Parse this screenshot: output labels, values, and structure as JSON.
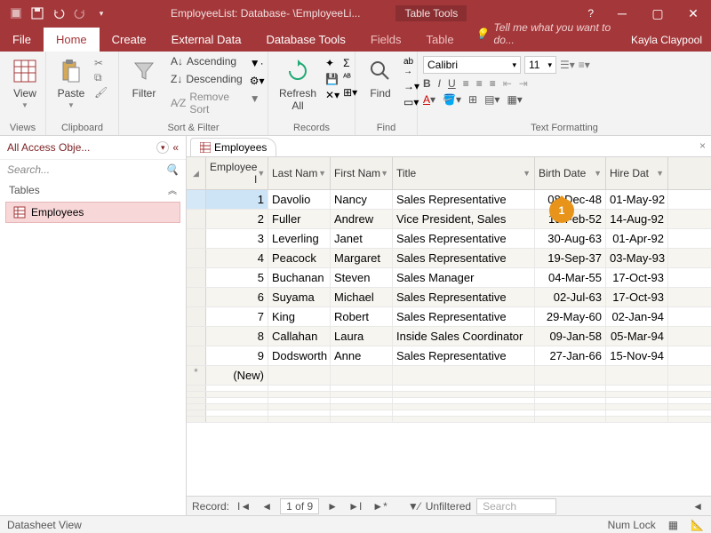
{
  "titlebar": {
    "app_title": "EmployeeList: Database- \\EmployeeLi...",
    "context_tab": "Table Tools",
    "help": "?"
  },
  "tabs": {
    "file": "File",
    "home": "Home",
    "create": "Create",
    "external": "External Data",
    "dbtools": "Database Tools",
    "fields": "Fields",
    "table": "Table",
    "tellme": "Tell me what you want to do...",
    "user": "Kayla Claypool"
  },
  "ribbon": {
    "views": {
      "view": "View",
      "label": "Views"
    },
    "clipboard": {
      "paste": "Paste",
      "label": "Clipboard"
    },
    "sort": {
      "filter": "Filter",
      "asc": "Ascending",
      "desc": "Descending",
      "remove": "Remove Sort",
      "label": "Sort & Filter"
    },
    "records": {
      "refresh": "Refresh\nAll",
      "label": "Records"
    },
    "find": {
      "find": "Find",
      "label": "Find"
    },
    "text": {
      "font": "Calibri",
      "size": "11",
      "label": "Text Formatting"
    }
  },
  "nav": {
    "header": "All Access Obje...",
    "search": "Search...",
    "group": "Tables",
    "item": "Employees"
  },
  "doc": {
    "tab": "Employees"
  },
  "columns": [
    "Employee I",
    "Last Nam",
    "First Nam",
    "Title",
    "Birth Date",
    "Hire Dat"
  ],
  "rows": [
    {
      "id": "1",
      "ln": "Davolio",
      "fn": "Nancy",
      "ti": "Sales Representative",
      "bd": "08-Dec-48",
      "hd": "01-May-92"
    },
    {
      "id": "2",
      "ln": "Fuller",
      "fn": "Andrew",
      "ti": "Vice President, Sales",
      "bd": "19-Feb-52",
      "hd": "14-Aug-92"
    },
    {
      "id": "3",
      "ln": "Leverling",
      "fn": "Janet",
      "ti": "Sales Representative",
      "bd": "30-Aug-63",
      "hd": "01-Apr-92"
    },
    {
      "id": "4",
      "ln": "Peacock",
      "fn": "Margaret",
      "ti": "Sales Representative",
      "bd": "19-Sep-37",
      "hd": "03-May-93"
    },
    {
      "id": "5",
      "ln": "Buchanan",
      "fn": "Steven",
      "ti": "Sales Manager",
      "bd": "04-Mar-55",
      "hd": "17-Oct-93"
    },
    {
      "id": "6",
      "ln": "Suyama",
      "fn": "Michael",
      "ti": "Sales Representative",
      "bd": "02-Jul-63",
      "hd": "17-Oct-93"
    },
    {
      "id": "7",
      "ln": "King",
      "fn": "Robert",
      "ti": "Sales Representative",
      "bd": "29-May-60",
      "hd": "02-Jan-94"
    },
    {
      "id": "8",
      "ln": "Callahan",
      "fn": "Laura",
      "ti": "Inside Sales Coordinator",
      "bd": "09-Jan-58",
      "hd": "05-Mar-94"
    },
    {
      "id": "9",
      "ln": "Dodsworth",
      "fn": "Anne",
      "ti": "Sales Representative",
      "bd": "27-Jan-66",
      "hd": "15-Nov-94"
    }
  ],
  "newrow": "(New)",
  "recnav": {
    "label": "Record:",
    "pos": "1 of 9",
    "nofilter": "Unfiltered",
    "search": "Search"
  },
  "status": {
    "view": "Datasheet View",
    "numlock": "Num Lock"
  },
  "callout": "1"
}
